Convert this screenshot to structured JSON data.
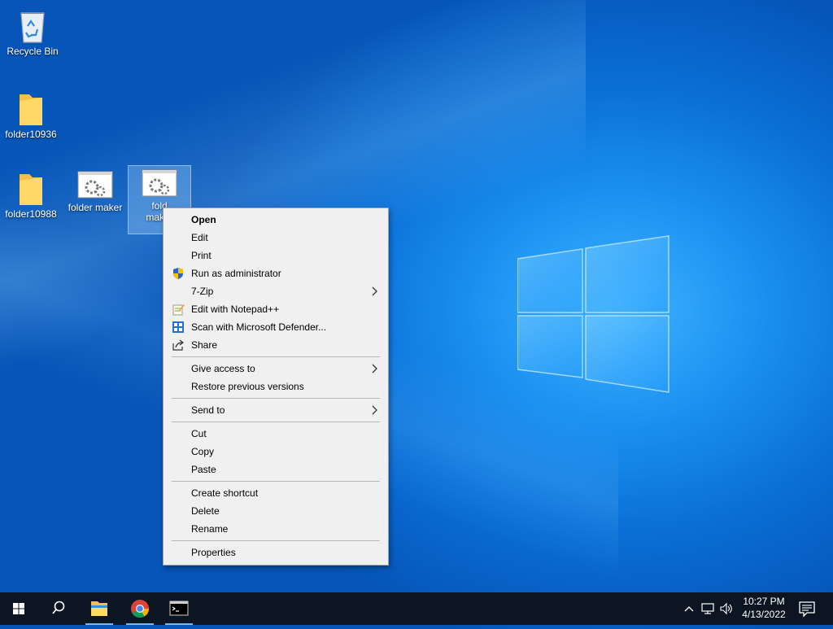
{
  "desktop": {
    "icons": [
      {
        "label": "Recycle Bin"
      },
      {
        "label": "folder10936"
      },
      {
        "label": "folder10988"
      },
      {
        "label": "folder maker"
      },
      {
        "label": "fold\nmaker"
      }
    ]
  },
  "context_menu": {
    "items": {
      "open": "Open",
      "edit": "Edit",
      "print": "Print",
      "run_as_admin": "Run as administrator",
      "seven_zip": "7-Zip",
      "edit_notepadpp": "Edit with Notepad++",
      "scan_defender": "Scan with Microsoft Defender...",
      "share": "Share",
      "give_access": "Give access to",
      "restore_versions": "Restore previous versions",
      "send_to": "Send to",
      "cut": "Cut",
      "copy": "Copy",
      "paste": "Paste",
      "create_shortcut": "Create shortcut",
      "delete": "Delete",
      "rename": "Rename",
      "properties": "Properties"
    }
  },
  "taskbar": {
    "apps": [
      "start-icon",
      "search-icon",
      "file-explorer-icon",
      "chrome-icon",
      "cmd-icon"
    ],
    "clock": {
      "time": "10:27 PM",
      "date": "4/13/2022"
    },
    "colors": {
      "taskbar": "#0c1622",
      "accent": "#76b9ed"
    }
  }
}
